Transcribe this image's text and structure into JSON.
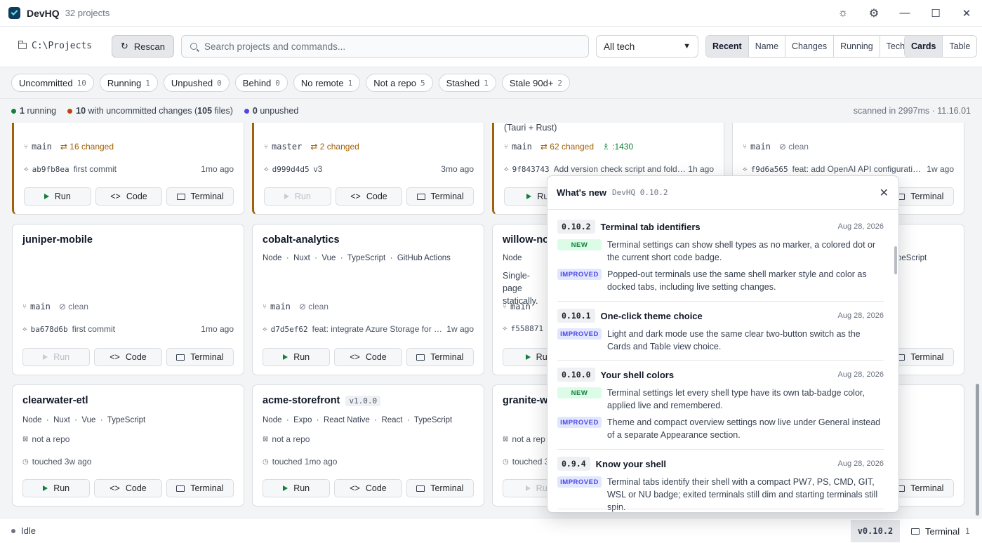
{
  "app": {
    "title": "DevHQ",
    "project_count": "32 projects"
  },
  "toolbar": {
    "path": "C:\\Projects",
    "rescan_label": "Rescan",
    "search_placeholder": "Search projects and commands...",
    "tech_filter": "All tech",
    "sort_options": [
      "Recent",
      "Name",
      "Changes",
      "Running",
      "Tech"
    ],
    "sort_active": "Recent",
    "view_options": [
      "Cards",
      "Table"
    ],
    "view_active": "Cards"
  },
  "filters": [
    {
      "label": "Uncommitted",
      "count": "10"
    },
    {
      "label": "Running",
      "count": "1"
    },
    {
      "label": "Unpushed",
      "count": "0"
    },
    {
      "label": "Behind",
      "count": "0"
    },
    {
      "label": "No remote",
      "count": "1"
    },
    {
      "label": "Not a repo",
      "count": "5"
    },
    {
      "label": "Stashed",
      "count": "1"
    },
    {
      "label": "Stale 90d+",
      "count": "2"
    }
  ],
  "summary": {
    "running_count": "1",
    "running_label": "running",
    "uncommitted_count": "10",
    "uncommitted_label": "with uncommitted changes (",
    "files_count": "105",
    "files_label": "files)",
    "unpushed_count": "0",
    "unpushed_label": "unpushed",
    "scan_info": "scanned in 2997ms · 11.16.01",
    "colors": {
      "running": "#15803d",
      "uncommitted": "#c2410c",
      "unpushed": "#4f46e5"
    }
  },
  "cards": {
    "r1c1": {
      "branch": "main",
      "changes": "16 changed",
      "hash": "ab9fb8ea",
      "message": "first commit",
      "age": "1mo ago",
      "run": "Run",
      "code": "Code",
      "terminal": "Terminal"
    },
    "r1c2": {
      "branch": "master",
      "changes": "2 changed",
      "hash": "d999d4d5",
      "message": "v3",
      "age": "3mo ago",
      "run": "Run",
      "code": "Code",
      "terminal": "Terminal"
    },
    "r1c3": {
      "tech_tail": "(Tauri + Rust)",
      "branch": "main",
      "changes": "62 changed",
      "port": ":1430",
      "hash": "9f843743",
      "message": "Add version check script and folder ...",
      "age": "1h ago",
      "run": "Ru"
    },
    "r1c4": {
      "branch": "main",
      "status": "clean",
      "hash": "f9d6a565",
      "message": "feat: add OpenAI API configuration ...",
      "age": "1w ago",
      "terminal": "Terminal"
    },
    "r2c1": {
      "name": "juniper-mobile",
      "branch": "main",
      "status": "clean",
      "hash": "ba678d6b",
      "message": "first commit",
      "age": "1mo ago",
      "run": "Run",
      "code": "Code",
      "terminal": "Terminal"
    },
    "r2c2": {
      "name": "cobalt-analytics",
      "tech": [
        "Node",
        "Nuxt",
        "Vue",
        "TypeScript",
        "GitHub Actions"
      ],
      "branch": "main",
      "status": "clean",
      "hash": "d7d5ef62",
      "message": "feat: integrate Azure Storage for ac...",
      "age": "1w ago",
      "run": "Run",
      "code": "Code",
      "terminal": "Terminal"
    },
    "r2c3": {
      "name": "willow-no",
      "tech_first": "Node",
      "desc": "Single-page statically.",
      "branch": "main",
      "hash": "f558871",
      "run": "Ru"
    },
    "r2c4": {
      "tech_tail": "peScript",
      "terminal": "Terminal"
    },
    "r3c1": {
      "name": "clearwater-etl",
      "tech": [
        "Node",
        "Nuxt",
        "Vue",
        "TypeScript"
      ],
      "repo": "not a repo",
      "touched": "touched 3w ago",
      "run": "Run",
      "code": "Code",
      "terminal": "Terminal"
    },
    "r3c2": {
      "name": "acme-storefront",
      "version": "v1.0.0",
      "tech": [
        "Node",
        "Expo",
        "React Native",
        "React",
        "TypeScript"
      ],
      "repo": "not a repo",
      "touched": "touched 1mo ago",
      "run": "Run",
      "code": "Code",
      "terminal": "Terminal"
    },
    "r3c3": {
      "name": "granite-w",
      "repo": "not a rep",
      "touched": "touched 3",
      "run": "Ru"
    },
    "r3c4": {
      "terminal": "Terminal"
    }
  },
  "popup": {
    "title": "What's new",
    "version": "DevHQ 0.10.2",
    "entries": [
      {
        "version": "0.10.2",
        "title": "Terminal tab identifiers",
        "date": "Aug 28, 2026",
        "items": [
          {
            "tag": "NEW",
            "text": "Terminal settings can show shell types as no marker, a colored dot or the current short code badge."
          },
          {
            "tag": "IMPROVED",
            "text": "Popped-out terminals use the same shell marker style and color as docked tabs, including live setting changes."
          }
        ]
      },
      {
        "version": "0.10.1",
        "title": "One-click theme choice",
        "date": "Aug 28, 2026",
        "items": [
          {
            "tag": "IMPROVED",
            "text": "Light and dark mode use the same clear two-button switch as the Cards and Table view choice."
          }
        ]
      },
      {
        "version": "0.10.0",
        "title": "Your shell colors",
        "date": "Aug 28, 2026",
        "items": [
          {
            "tag": "NEW",
            "text": "Terminal settings let every shell type have its own tab-badge color, applied live and remembered."
          },
          {
            "tag": "IMPROVED",
            "text": "Theme and compact overview settings now live under General instead of a separate Appearance section."
          }
        ]
      },
      {
        "version": "0.9.4",
        "title": "Know your shell",
        "date": "Aug 28, 2026",
        "items": [
          {
            "tag": "IMPROVED",
            "text": "Terminal tabs identify their shell with a compact PW7, PS, CMD, GIT, WSL or NU badge; exited terminals still dim and starting terminals still spin."
          }
        ]
      }
    ]
  },
  "statusbar": {
    "idle": "Idle",
    "version": "v0.10.2",
    "terminal_label": "Terminal",
    "terminal_count": "1"
  }
}
